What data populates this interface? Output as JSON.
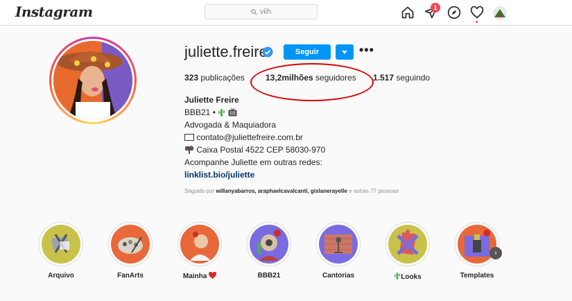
{
  "nav": {
    "logo": "Instagram",
    "search_value": "viih",
    "notification_count": "1"
  },
  "profile": {
    "username": "juliette.freire",
    "follow_label": "Seguir",
    "more_label": "•••",
    "stats": {
      "posts_value": "323",
      "posts_label": "publicações",
      "followers_value": "13,2milhões",
      "followers_label": "seguidores",
      "following_value": "1.517",
      "following_label": "seguindo"
    },
    "bio": {
      "full_name": "Juliette Freire",
      "line1": "BBB21 •",
      "line2": "Advogada & Maquiadora",
      "email": "contato@juliettefreire.com.br",
      "postal": "Caixa Postal 4522 CEP 58030-970",
      "cta": "Acompanhe Juliette em outras redes:",
      "link": "linklist.bio/juliette"
    },
    "followed_by": {
      "prefix": "Seguido por",
      "names": "willanyabarros, araphaelcavalcanti, gislanerayelle",
      "suffix": "e outras 77 pessoas"
    }
  },
  "highlights": [
    {
      "label": "Arquivo",
      "bg": "#c9c24a"
    },
    {
      "label": "FanArts",
      "bg": "#e8683a"
    },
    {
      "label": "Mainha",
      "bg": "#e8683a"
    },
    {
      "label": "BBB21",
      "bg": "#7b6be0"
    },
    {
      "label": "Cantorias",
      "bg": "#7b6be0"
    },
    {
      "label": "Looks",
      "bg": "#c9c24a"
    },
    {
      "label": "Templates",
      "bg": "#e8683a"
    }
  ],
  "colors": {
    "accent": "#0095f6",
    "badge": "#ed4956",
    "annotation": "#dd0000"
  }
}
